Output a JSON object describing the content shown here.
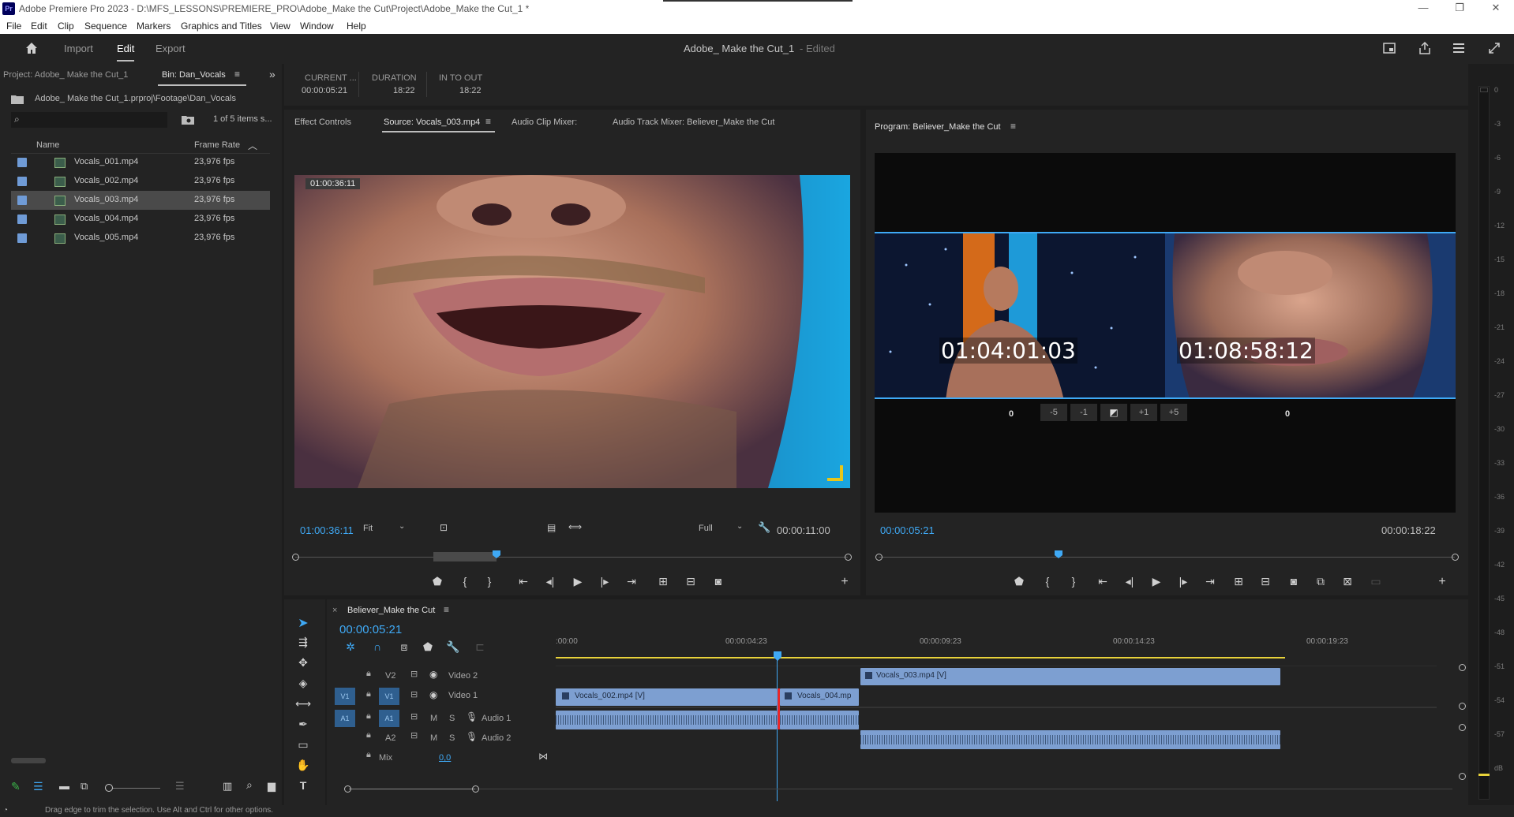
{
  "window": {
    "title": "Adobe Premiere Pro 2023 - D:\\MFS_LESSONS\\PREMIERE_PRO\\Adobe_Make the Cut\\Project\\Adobe_Make the Cut_1 *",
    "app_icon": "Pr"
  },
  "menu": [
    "File",
    "Edit",
    "Clip",
    "Sequence",
    "Markers",
    "Graphics and Titles",
    "View",
    "Window",
    "Help"
  ],
  "header": {
    "tabs": [
      "Import",
      "Edit",
      "Export"
    ],
    "active_tab": "Edit",
    "project_name": "Adobe_ Make the Cut_1",
    "edited": "- Edited"
  },
  "project_panel": {
    "tab_project": "Project: Adobe_ Make the Cut_1",
    "tab_bin": "Bin: Dan_Vocals",
    "path": "Adobe_ Make the Cut_1.prproj\\Footage\\Dan_Vocals",
    "items_count": "1 of 5 items s...",
    "col_name": "Name",
    "col_rate": "Frame Rate",
    "items": [
      {
        "name": "Vocals_001.mp4",
        "rate": "23,976 fps"
      },
      {
        "name": "Vocals_002.mp4",
        "rate": "23,976 fps"
      },
      {
        "name": "Vocals_003.mp4",
        "rate": "23,976 fps"
      },
      {
        "name": "Vocals_004.mp4",
        "rate": "23,976 fps"
      },
      {
        "name": "Vocals_005.mp4",
        "rate": "23,976 fps"
      }
    ]
  },
  "info": {
    "current_label": "CURRENT ...",
    "current_value": "00:00:05:21",
    "duration_label": "DURATION",
    "duration_value": "18:22",
    "inout_label": "IN TO OUT",
    "inout_value": "18:22"
  },
  "source_panel": {
    "tabs": [
      "Effect Controls",
      "Source: Vocals_003.mp4",
      "Audio Clip Mixer:",
      "Audio Track Mixer: Believer_Make the Cut"
    ],
    "overlay_tc": "01:00:36:11",
    "timecode": "01:00:36:11",
    "zoom": "Fit",
    "quality": "Full",
    "duration": "00:00:11:00"
  },
  "program_panel": {
    "title": "Program: Believer_Make the Cut",
    "left_tc": "01:04:01:03",
    "right_tc": "01:08:58:12",
    "trim_left": "0",
    "trim_right": "0",
    "trim_buttons": [
      "-5",
      "-1",
      "+1",
      "+5"
    ],
    "timecode": "00:00:05:21",
    "duration": "00:00:18:22"
  },
  "timeline": {
    "title": "Believer_Make the Cut",
    "timecode": "00:00:05:21",
    "ruler": [
      ":00:00",
      "00:00:04:23",
      "00:00:09:23",
      "00:00:14:23",
      "00:00:19:23"
    ],
    "tracks": {
      "v2": "V2",
      "v2_name": "Video 2",
      "v1_src": "V1",
      "v1": "V1",
      "v1_name": "Video 1",
      "a1_src": "A1",
      "a1": "A1",
      "a1_name": "Audio 1",
      "a2": "A2",
      "a2_name": "Audio 2",
      "m": "M",
      "s": "S",
      "mix": "Mix",
      "mix_value": "0,0"
    },
    "clips": {
      "c1": "Vocals_002.mp4 [V]",
      "c2": "Vocals_004.mp",
      "c3": "Vocals_003.mp4 [V]"
    }
  },
  "meter": {
    "ticks": [
      "0",
      "-3",
      "-6",
      "-9",
      "-12",
      "-15",
      "-18",
      "-21",
      "-24",
      "-27",
      "-30",
      "-33",
      "-36",
      "-39",
      "-42",
      "-45",
      "-48",
      "-51",
      "-54",
      "-57",
      "dB"
    ]
  },
  "status": "Drag edge to trim the selection. Use Alt and Ctrl for other options."
}
